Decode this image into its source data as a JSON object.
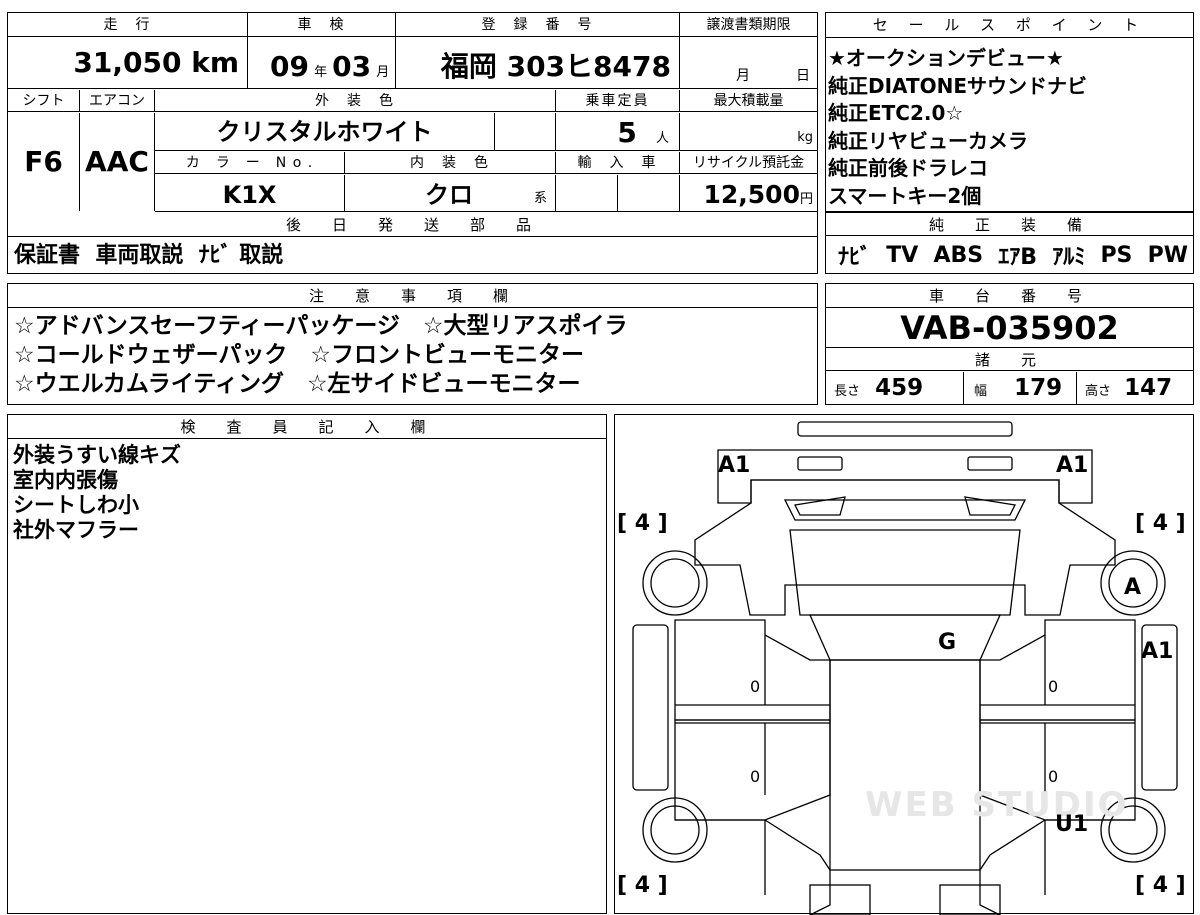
{
  "top_table": {
    "headers": {
      "mileage": "走　行",
      "inspection": "車　検",
      "registration": "登　録　番　号",
      "transfer_deadline": "譲渡書類期限"
    },
    "mileage_value": "31,050 km",
    "inspection_year": "09",
    "inspection_year_unit": "年",
    "inspection_month": "03",
    "inspection_month_unit": "月",
    "registration_value": "福岡 303ヒ8478",
    "transfer_month_unit": "月",
    "transfer_day_unit": "日",
    "row2_headers": {
      "shift": "シフト",
      "aircon": "エアコン",
      "exterior_color": "外　装　色",
      "capacity": "乗車定員",
      "max_load": "最大積載量"
    },
    "shift_value": "F6",
    "aircon_value": "AAC",
    "exterior_color_value": "クリスタルホワイト",
    "capacity_value": "5",
    "capacity_unit": "人",
    "max_load_unit": "kg",
    "row3_headers": {
      "color_no": "カ　ラ　ー　N o .",
      "interior_color": "内　装　色",
      "import": "輸　入　車",
      "recycle": "リサイクル預託金"
    },
    "color_no_value": "K1X",
    "interior_color_value": "クロ",
    "interior_color_suffix": "系",
    "recycle_value": "12,500",
    "recycle_unit": "円",
    "later_parts_header": "後　日　発　送　部　品",
    "later_parts_value": "保証書  車両取説  ﾅﾋﾞ 取説"
  },
  "sales_points": {
    "header": "セ ー ル ス ポ イ ン ト",
    "lines": [
      "★オークションデビュー★",
      "純正DIATONEサウンドナビ",
      "純正ETC2.0☆",
      "純正リヤビューカメラ",
      "純正前後ドラレコ",
      "スマートキー2個"
    ]
  },
  "genuine_equipment": {
    "header": "純　正　装　備",
    "items": [
      "ﾅﾋﾞ",
      "TV",
      "ABS",
      "ｴｱB",
      "ｱﾙﾐ",
      "PS",
      "PW"
    ]
  },
  "notes": {
    "header": "注　意　事　項　欄",
    "lines": [
      "☆アドバンスセーフティーパッケージ　☆大型リアスポイラ",
      "☆コールドウェザーパック　☆フロントビューモニター",
      "☆ウエルカムライティング　☆左サイドビューモニター"
    ]
  },
  "chassis": {
    "header": "車　台　番　号",
    "value": "VAB-035902"
  },
  "specs": {
    "header": "諸　元",
    "length_label": "長さ",
    "length_value": "459",
    "width_label": "幅",
    "width_value": "179",
    "height_label": "高さ",
    "height_value": "147"
  },
  "inspector": {
    "header": "検　査　員　記　入　欄",
    "lines": [
      "外装うすい線キズ",
      "室内内張傷",
      "シートしわ小",
      "社外マフラー"
    ]
  },
  "diagram": {
    "marks": {
      "front_left": "A1",
      "front_right": "A1",
      "tire_fl": "[ 4 ]",
      "tire_fr": "[ 4 ]",
      "tire_rl": "[ 4 ]",
      "tire_rr": "[ 4 ]",
      "wheel_right_front": "A",
      "windshield": "G",
      "right_fender": "A1",
      "right_rear": "U1",
      "door_lf": "0",
      "door_rf": "0",
      "door_lr": "0",
      "door_rr": "0"
    },
    "watermark": "WEB STUDIO"
  }
}
